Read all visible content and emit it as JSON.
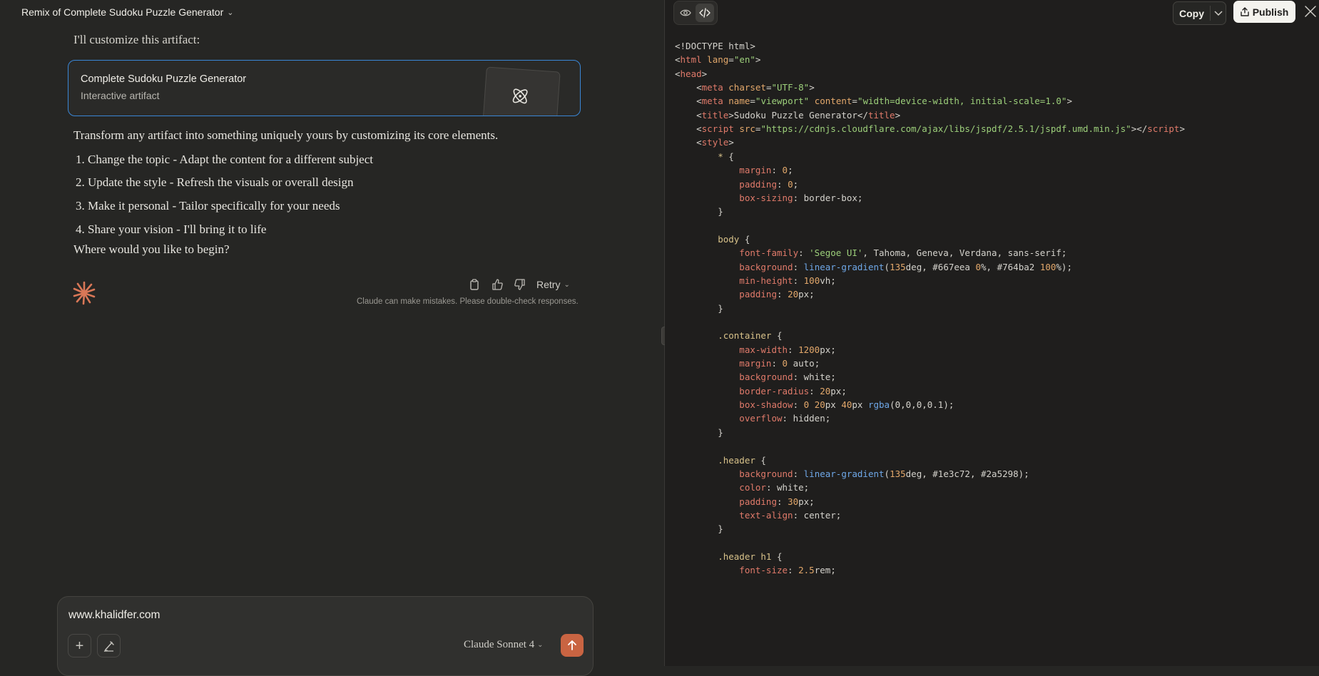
{
  "header": {
    "title": "Remix of Complete Sudoku Puzzle Generator"
  },
  "chat": {
    "intro": "I'll customize this artifact:",
    "artifact": {
      "title": "Complete Sudoku Puzzle Generator",
      "subtitle": "Interactive artifact"
    },
    "paragraph": "Transform any artifact into something uniquely yours by customizing its core elements.",
    "items": [
      "1. Change the topic - Adapt the content for a different subject",
      "2. Update the style - Refresh the visuals or overall design",
      "3. Make it personal - Tailor specifically for your needs",
      "4. Share your vision - I'll bring it to life"
    ],
    "question": "Where would you like to begin?",
    "retry_label": "Retry",
    "disclaimer": "Claude can make mistakes. Please double-check responses."
  },
  "composer": {
    "text": "www.khalidfer.com",
    "model": "Claude Sonnet 4"
  },
  "panel": {
    "copy_label": "Copy",
    "publish_label": "Publish"
  },
  "code": {
    "lines": [
      [
        [
          "pun",
          "<!DOCTYPE html>"
        ]
      ],
      [
        [
          "pun",
          "<"
        ],
        [
          "tag",
          "html"
        ],
        [
          "attr",
          " lang"
        ],
        [
          "pun",
          "="
        ],
        [
          "str",
          "\"en\""
        ],
        [
          "pun",
          ">"
        ]
      ],
      [
        [
          "pun",
          "<"
        ],
        [
          "tag",
          "head"
        ],
        [
          "pun",
          ">"
        ]
      ],
      [
        [
          "pun",
          "    <"
        ],
        [
          "tag",
          "meta"
        ],
        [
          "attr",
          " charset"
        ],
        [
          "pun",
          "="
        ],
        [
          "str",
          "\"UTF-8\""
        ],
        [
          "pun",
          ">"
        ]
      ],
      [
        [
          "pun",
          "    <"
        ],
        [
          "tag",
          "meta"
        ],
        [
          "attr",
          " name"
        ],
        [
          "pun",
          "="
        ],
        [
          "str",
          "\"viewport\""
        ],
        [
          "attr",
          " content"
        ],
        [
          "pun",
          "="
        ],
        [
          "str",
          "\"width=device-width, initial-scale=1.0\""
        ],
        [
          "pun",
          ">"
        ]
      ],
      [
        [
          "pun",
          "    <"
        ],
        [
          "tag",
          "title"
        ],
        [
          "pun",
          ">Sudoku Puzzle Generator</"
        ],
        [
          "tag",
          "title"
        ],
        [
          "pun",
          ">"
        ]
      ],
      [
        [
          "pun",
          "    <"
        ],
        [
          "tag",
          "script"
        ],
        [
          "attr",
          " src"
        ],
        [
          "pun",
          "="
        ],
        [
          "str",
          "\"https://cdnjs.cloudflare.com/ajax/libs/jspdf/2.5.1/jspdf.umd.min.js\""
        ],
        [
          "pun",
          "></"
        ],
        [
          "tag",
          "script"
        ],
        [
          "pun",
          ">"
        ]
      ],
      [
        [
          "pun",
          "    <"
        ],
        [
          "tag",
          "style"
        ],
        [
          "pun",
          ">"
        ]
      ],
      [
        [
          "sel",
          "        * "
        ],
        [
          "pun",
          "{"
        ]
      ],
      [
        [
          "prop",
          "            margin"
        ],
        [
          "pun",
          ": "
        ],
        [
          "num",
          "0"
        ],
        [
          "pun",
          ";"
        ]
      ],
      [
        [
          "prop",
          "            padding"
        ],
        [
          "pun",
          ": "
        ],
        [
          "num",
          "0"
        ],
        [
          "pun",
          ";"
        ]
      ],
      [
        [
          "prop",
          "            box-sizing"
        ],
        [
          "pun",
          ": border-box;"
        ]
      ],
      [
        [
          "pun",
          "        }"
        ]
      ],
      [
        [
          "pun",
          ""
        ]
      ],
      [
        [
          "sel",
          "        body "
        ],
        [
          "pun",
          "{"
        ]
      ],
      [
        [
          "prop",
          "            font-family"
        ],
        [
          "pun",
          ": "
        ],
        [
          "str",
          "'Segoe UI'"
        ],
        [
          "pun",
          ", Tahoma, Geneva, Verdana, sans-serif;"
        ]
      ],
      [
        [
          "prop",
          "            background"
        ],
        [
          "pun",
          ": "
        ],
        [
          "fn",
          "linear-gradient"
        ],
        [
          "pun",
          "("
        ],
        [
          "num",
          "135"
        ],
        [
          "pun",
          "deg, #667eea "
        ],
        [
          "num",
          "0"
        ],
        [
          "pun",
          "%, #764ba2 "
        ],
        [
          "num",
          "100"
        ],
        [
          "pun",
          "%);"
        ]
      ],
      [
        [
          "prop",
          "            min-height"
        ],
        [
          "pun",
          ": "
        ],
        [
          "num",
          "100"
        ],
        [
          "pun",
          "vh;"
        ]
      ],
      [
        [
          "prop",
          "            padding"
        ],
        [
          "pun",
          ": "
        ],
        [
          "num",
          "20"
        ],
        [
          "pun",
          "px;"
        ]
      ],
      [
        [
          "pun",
          "        }"
        ]
      ],
      [
        [
          "pun",
          ""
        ]
      ],
      [
        [
          "sel",
          "        .container "
        ],
        [
          "pun",
          "{"
        ]
      ],
      [
        [
          "prop",
          "            max-width"
        ],
        [
          "pun",
          ": "
        ],
        [
          "num",
          "1200"
        ],
        [
          "pun",
          "px;"
        ]
      ],
      [
        [
          "prop",
          "            margin"
        ],
        [
          "pun",
          ": "
        ],
        [
          "num",
          "0"
        ],
        [
          "pun",
          " auto;"
        ]
      ],
      [
        [
          "prop",
          "            background"
        ],
        [
          "pun",
          ": white;"
        ]
      ],
      [
        [
          "prop",
          "            border-radius"
        ],
        [
          "pun",
          ": "
        ],
        [
          "num",
          "20"
        ],
        [
          "pun",
          "px;"
        ]
      ],
      [
        [
          "prop",
          "            box-shadow"
        ],
        [
          "pun",
          ": "
        ],
        [
          "num",
          "0 20"
        ],
        [
          "pun",
          "px "
        ],
        [
          "num",
          "40"
        ],
        [
          "pun",
          "px "
        ],
        [
          "fn",
          "rgba"
        ],
        [
          "pun",
          "(0,0,0,0.1);"
        ]
      ],
      [
        [
          "prop",
          "            overflow"
        ],
        [
          "pun",
          ": hidden;"
        ]
      ],
      [
        [
          "pun",
          "        }"
        ]
      ],
      [
        [
          "pun",
          ""
        ]
      ],
      [
        [
          "sel",
          "        .header "
        ],
        [
          "pun",
          "{"
        ]
      ],
      [
        [
          "prop",
          "            background"
        ],
        [
          "pun",
          ": "
        ],
        [
          "fn",
          "linear-gradient"
        ],
        [
          "pun",
          "("
        ],
        [
          "num",
          "135"
        ],
        [
          "pun",
          "deg, #1e3c72, #2a5298);"
        ]
      ],
      [
        [
          "prop",
          "            color"
        ],
        [
          "pun",
          ": white;"
        ]
      ],
      [
        [
          "prop",
          "            padding"
        ],
        [
          "pun",
          ": "
        ],
        [
          "num",
          "30"
        ],
        [
          "pun",
          "px;"
        ]
      ],
      [
        [
          "prop",
          "            text-align"
        ],
        [
          "pun",
          ": center;"
        ]
      ],
      [
        [
          "pun",
          "        }"
        ]
      ],
      [
        [
          "pun",
          ""
        ]
      ],
      [
        [
          "sel",
          "        .header h1 "
        ],
        [
          "pun",
          "{"
        ]
      ],
      [
        [
          "prop",
          "            font-size"
        ],
        [
          "pun",
          ": "
        ],
        [
          "num",
          "2.5"
        ],
        [
          "pun",
          "rem;"
        ]
      ]
    ]
  },
  "colors": {
    "accent": "#c96442",
    "artifact_border": "#3a86d6",
    "left_bg": "#262624",
    "right_bg": "#1f1e1d"
  }
}
